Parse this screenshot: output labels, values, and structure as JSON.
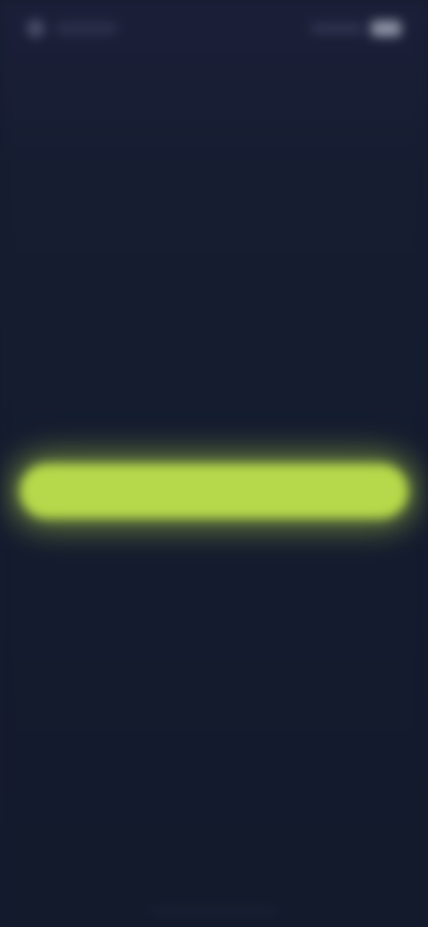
{
  "status_bar": {
    "icons": [
      "notification-dot-icon",
      "signal-icon",
      "battery-icon"
    ]
  },
  "main": {
    "title": "",
    "subtitle": "",
    "description": ""
  },
  "cta": {
    "label": ""
  },
  "terms": {
    "text": "",
    "link_text": ""
  },
  "footer": {
    "link_text": ""
  },
  "colors": {
    "background": "#151c2f",
    "accent": "#b5d94a",
    "title_text": "#dde2f0",
    "muted_text": "#8b93a8"
  }
}
